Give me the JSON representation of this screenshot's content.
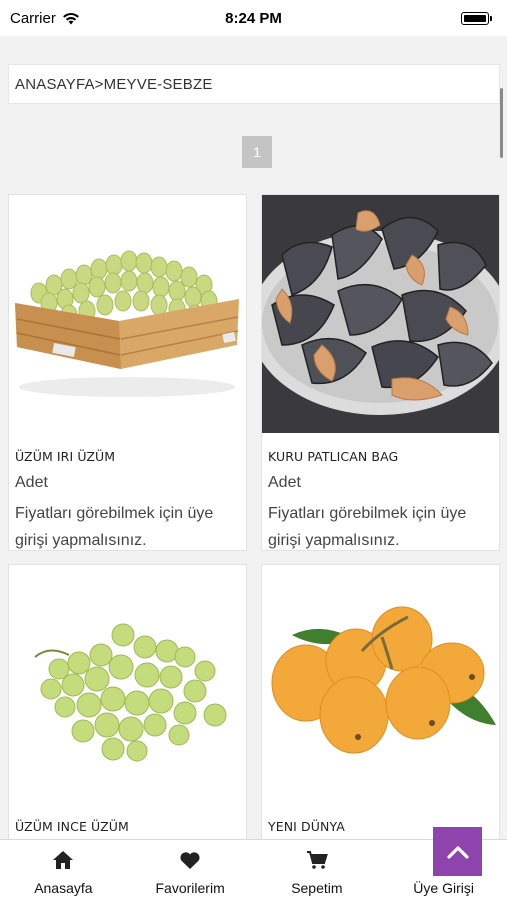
{
  "status_bar": {
    "carrier": "Carrier",
    "time": "8:24 PM"
  },
  "breadcrumb": "ANASAYFA>MEYVE-SEBZE",
  "pagination": {
    "current_page": "1"
  },
  "products": [
    {
      "name": "ÜZÜM IRI ÜZÜM",
      "unit": "Adet",
      "price_note": "Fiyatları görebilmek için üye girişi yapmalısınız.",
      "image": "grapes-in-crate"
    },
    {
      "name": "KURU PATLICAN BAG",
      "unit": "Adet",
      "price_note": "Fiyatları görebilmek için üye girişi yapmalısınız.",
      "image": "dried-eggplant"
    },
    {
      "name": "ÜZÜM INCE ÜZÜM",
      "image": "green-grape-bunch"
    },
    {
      "name": "YENI DÜNYA",
      "image": "loquats"
    }
  ],
  "bottom_nav": [
    {
      "label": "Anasayfa",
      "icon": "home-icon"
    },
    {
      "label": "Favorilerim",
      "icon": "heart-icon"
    },
    {
      "label": "Sepetim",
      "icon": "cart-icon"
    },
    {
      "label": "Üye Girişi",
      "icon": "user-icon"
    }
  ],
  "colors": {
    "accent": "#8e44ad",
    "pagination_bg": "#c4c4c4",
    "page_bg": "#f2f2f2"
  }
}
